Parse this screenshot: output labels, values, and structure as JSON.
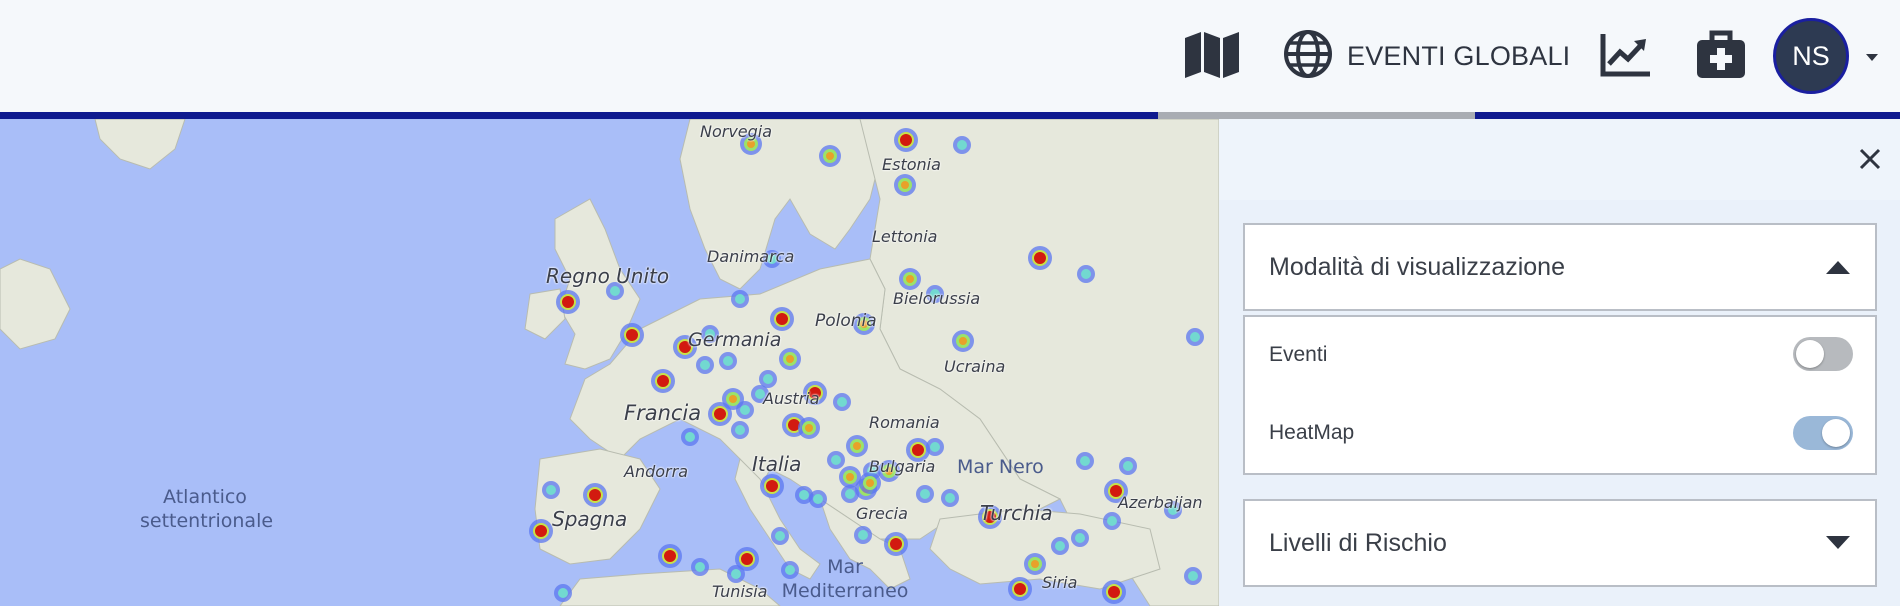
{
  "nav": {
    "map_icon": "map-icon",
    "global_icon": "globe-icon",
    "global_label": "EVENTI GLOBALI",
    "trend_icon": "chart-line-icon",
    "kit_icon": "first-aid-kit-icon",
    "avatar_initials": "NS"
  },
  "map": {
    "country_labels": [
      "Norvegia",
      "Estonia",
      "Lettonia",
      "Danimarca",
      "Regno Unito",
      "Bielorussia",
      "Polonia",
      "Germania",
      "Ucraina",
      "Francia",
      "Austria",
      "Romania",
      "Italia",
      "Bulgaria",
      "Andorra",
      "Spagna",
      "Grecia",
      "Turchia",
      "Azerbaijan",
      "Tunisia",
      "Siria"
    ],
    "sea_labels": [
      "Atlantico settentrionale",
      "Mar Nero",
      "Mar Mediterraneo"
    ]
  },
  "panel": {
    "section_display": {
      "title": "Modalità di visualizzazione",
      "expanded": true,
      "toggles": [
        {
          "label": "Eventi",
          "on": false
        },
        {
          "label": "HeatMap",
          "on": true
        }
      ]
    },
    "section_risk": {
      "title": "Livelli di Rischio",
      "expanded": false
    }
  },
  "colors": {
    "progress": "#0f1a8f",
    "avatar_bg": "#2d3a52",
    "toggle_on": "#9ab8d8",
    "toggle_off": "#b7babe",
    "sea": "#a9bef8"
  }
}
